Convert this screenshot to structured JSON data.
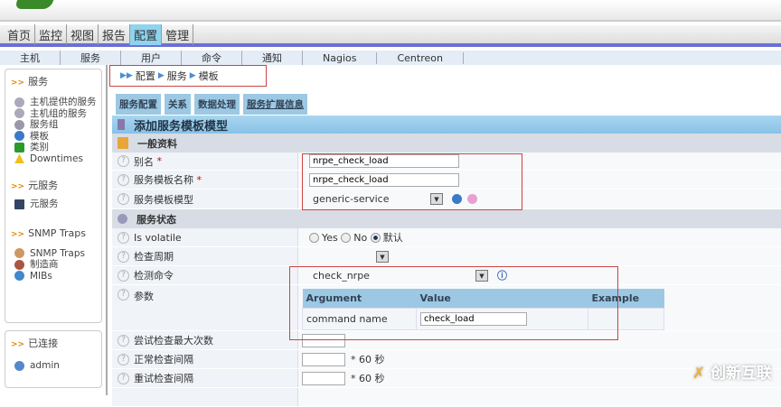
{
  "menu": [
    "首页",
    "监控",
    "视图",
    "报告",
    "配置",
    "管理"
  ],
  "submenu": [
    "主机",
    "服务",
    "用户",
    "命令",
    "通知",
    "Nagios",
    "Centreon"
  ],
  "sidebar": {
    "section1": "服务",
    "items1": [
      "主机提供的服务",
      "主机组的服务",
      "服务组",
      "模板",
      "类别",
      "Downtimes"
    ],
    "section2": "元服务",
    "items2": [
      "元服务"
    ],
    "section3": "SNMP Traps",
    "items3": [
      "SNMP Traps",
      "制造商",
      "MIBs"
    ],
    "connected": "已连接",
    "user": "admin"
  },
  "breadcrumb": [
    "配置",
    "服务",
    "模板"
  ],
  "tabs": [
    "服务配置",
    "关系",
    "数据处理",
    "服务扩展信息"
  ],
  "form": {
    "title": "添加服务模板模型",
    "section_general": "一般资料",
    "alias_label": "别名",
    "alias_value": "nrpe_check_load",
    "name_label": "服务模板名称",
    "name_value": "nrpe_check_load",
    "template_label": "服务模板模型",
    "template_value": "generic-service",
    "section_state": "服务状态",
    "volatile_label": "Is volatile",
    "yes": "Yes",
    "no": "No",
    "default": "默认",
    "period_label": "检查周期",
    "command_label": "检测命令",
    "command_value": "check_nrpe",
    "args_label": "参数",
    "args_headers": [
      "Argument",
      "Value",
      "Example"
    ],
    "args_rows": [
      {
        "argument": "command name",
        "value": "check_load",
        "example": ""
      }
    ],
    "max_attempts_label": "尝试检查最大次数",
    "normal_interval_label": "正常检查间隔",
    "unit": "* 60 秒",
    "retry_interval_label": "重试检查间隔"
  },
  "watermark": "创新互联"
}
